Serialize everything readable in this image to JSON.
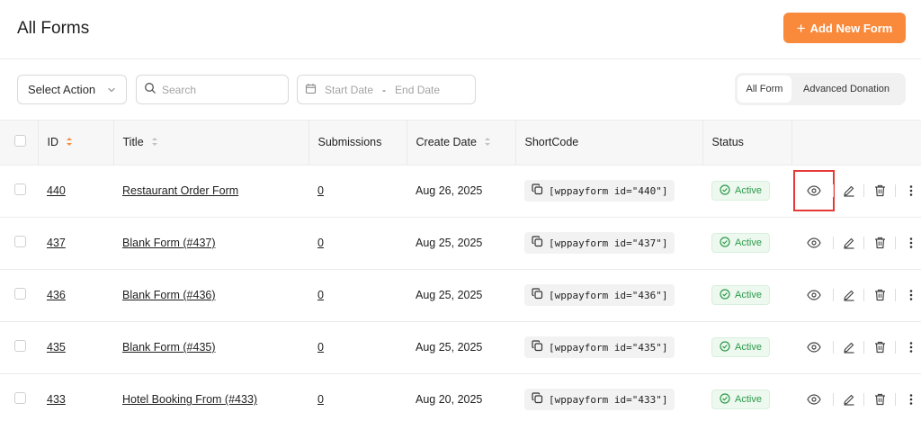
{
  "header": {
    "title": "All Forms",
    "add_button": "Add New Form"
  },
  "filters": {
    "select_action": "Select Action",
    "search_placeholder": "Search",
    "start_date": "Start Date",
    "date_separator": "-",
    "end_date": "End Date",
    "tabs": [
      "All Form",
      "Advanced Donation"
    ],
    "active_tab": "All Form"
  },
  "table": {
    "columns": {
      "id": "ID",
      "title": "Title",
      "submissions": "Submissions",
      "create_date": "Create Date",
      "shortcode": "ShortCode",
      "status": "Status"
    },
    "rows": [
      {
        "id": "440",
        "title": "Restaurant Order Form",
        "submissions": "0",
        "date": "Aug 26, 2025",
        "shortcode": "[wppayform id=\"440\"]",
        "status": "Active"
      },
      {
        "id": "437",
        "title": "Blank Form (#437)",
        "submissions": "0",
        "date": "Aug 25, 2025",
        "shortcode": "[wppayform id=\"437\"]",
        "status": "Active"
      },
      {
        "id": "436",
        "title": "Blank Form (#436)",
        "submissions": "0",
        "date": "Aug 25, 2025",
        "shortcode": "[wppayform id=\"436\"]",
        "status": "Active"
      },
      {
        "id": "435",
        "title": "Blank Form (#435)",
        "submissions": "0",
        "date": "Aug 25, 2025",
        "shortcode": "[wppayform id=\"435\"]",
        "status": "Active"
      },
      {
        "id": "433",
        "title": "Hotel Booking From (#433)",
        "submissions": "0",
        "date": "Aug 20, 2025",
        "shortcode": "[wppayform id=\"433\"]",
        "status": "Active"
      }
    ]
  },
  "colors": {
    "accent": "#f98a3c",
    "active_green": "#2c9a4a",
    "highlight_red": "#e53935"
  },
  "icons": {
    "add": "plus-icon",
    "select": "chevron-down-icon",
    "search": "search-icon",
    "date": "calendar-icon",
    "sort": "sort-icon",
    "copy": "copy-icon",
    "status": "check-circle-icon",
    "view": "eye-icon",
    "edit": "pencil-icon",
    "delete": "trash-icon",
    "more": "more-vertical-icon"
  }
}
